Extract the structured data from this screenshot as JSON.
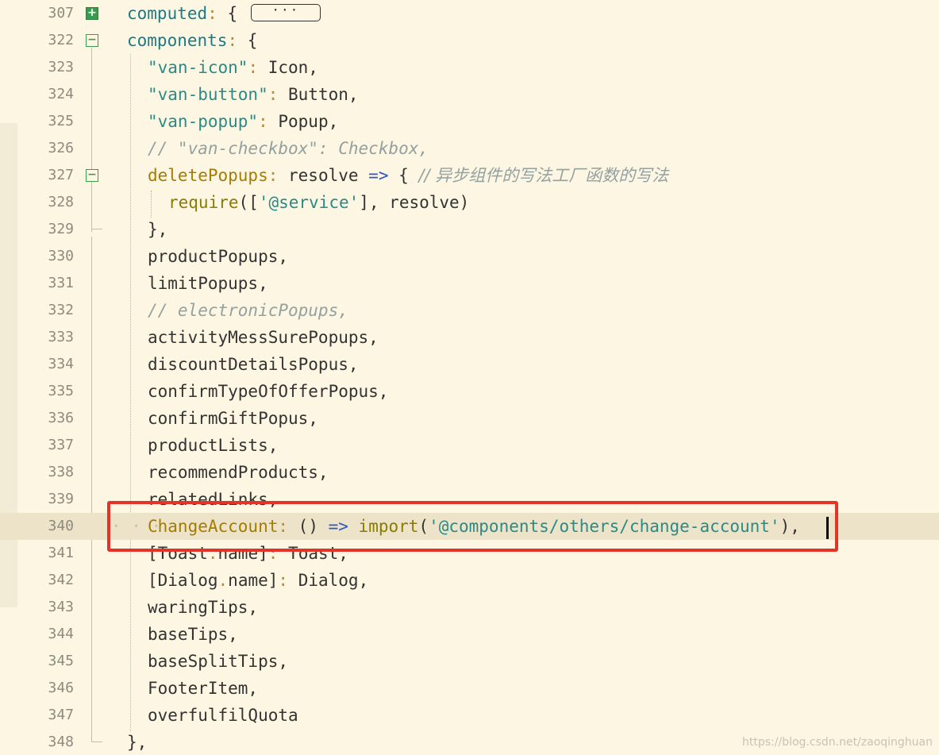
{
  "editor": {
    "lines": [
      {
        "num": "307",
        "fold": "expand"
      },
      {
        "num": "322",
        "fold": "collapse"
      },
      {
        "num": "323"
      },
      {
        "num": "324"
      },
      {
        "num": "325"
      },
      {
        "num": "326"
      },
      {
        "num": "327",
        "fold": "collapse"
      },
      {
        "num": "328"
      },
      {
        "num": "329"
      },
      {
        "num": "330"
      },
      {
        "num": "331"
      },
      {
        "num": "332"
      },
      {
        "num": "333"
      },
      {
        "num": "334"
      },
      {
        "num": "335"
      },
      {
        "num": "336"
      },
      {
        "num": "337"
      },
      {
        "num": "338"
      },
      {
        "num": "339"
      },
      {
        "num": "340"
      },
      {
        "num": "341"
      },
      {
        "num": "342"
      },
      {
        "num": "343"
      },
      {
        "num": "344"
      },
      {
        "num": "345"
      },
      {
        "num": "346"
      },
      {
        "num": "347"
      },
      {
        "num": "348"
      }
    ],
    "code": {
      "l307": {
        "prop": "computed",
        "colon": ":",
        "brace": " {",
        "ellipsis": "···"
      },
      "l322": {
        "prop": "components",
        "colon": ":",
        "brace": " {"
      },
      "l323": {
        "key": "\"van-icon\"",
        "colon": ":",
        "value": " Icon,"
      },
      "l324": {
        "key": "\"van-button\"",
        "colon": ":",
        "value": " Button,"
      },
      "l325": {
        "key": "\"van-popup\"",
        "colon": ":",
        "value": " Popup,"
      },
      "l326": {
        "comment": "// \"van-checkbox\": Checkbox,"
      },
      "l327": {
        "name": "deletePopups",
        "colon": ":",
        "param": " resolve ",
        "arrow": "=>",
        "brace": " { ",
        "comment": "// 异步组件的写法工厂函数的写法"
      },
      "l328": {
        "fn": "require",
        "open": "([",
        "str": "'@service'",
        "close": "], resolve)"
      },
      "l329": {
        "text": "},"
      },
      "l330": {
        "text": "productPopups,"
      },
      "l331": {
        "text": "limitPopups,"
      },
      "l332": {
        "comment": "// electronicPopups,"
      },
      "l333": {
        "text": "activityMessSurePopups,"
      },
      "l334": {
        "text": "discountDetailsPopus,"
      },
      "l335": {
        "text": "confirmTypeOfOfferPopus,"
      },
      "l336": {
        "text": "confirmGiftPopus,"
      },
      "l337": {
        "text": "productLists,"
      },
      "l338": {
        "text": "recommendProducts,"
      },
      "l339": {
        "text": "relatedLinks,"
      },
      "l340": {
        "name": "ChangeAccount",
        "colon": ":",
        "parens": " () ",
        "arrow": "=>",
        "fn": " import",
        "open": "(",
        "str": "'@components/others/change-account'",
        "close": "),"
      },
      "l341": {
        "open": "[Toast",
        "dot": ".",
        "member": "name",
        "close": "]",
        "colon": ":",
        "value": " Toast,"
      },
      "l342": {
        "open": "[Dialog",
        "dot": ".",
        "member": "name",
        "close": "]",
        "colon": ":",
        "value": " Dialog,"
      },
      "l343": {
        "text": "waringTips,"
      },
      "l344": {
        "text": "baseTips,"
      },
      "l345": {
        "text": "baseSplitTips,"
      },
      "l346": {
        "text": "FooterItem,"
      },
      "l347": {
        "text": "overfulfilQuota"
      },
      "l348": {
        "text": "},"
      }
    },
    "colors": {
      "background": "#fdf6e3",
      "highlight_border": "#e53327",
      "current_line": "#ece3c8",
      "fold_green": "#3a9b4f"
    }
  },
  "watermark": "https://blog.csdn.net/zaoqinghuan"
}
